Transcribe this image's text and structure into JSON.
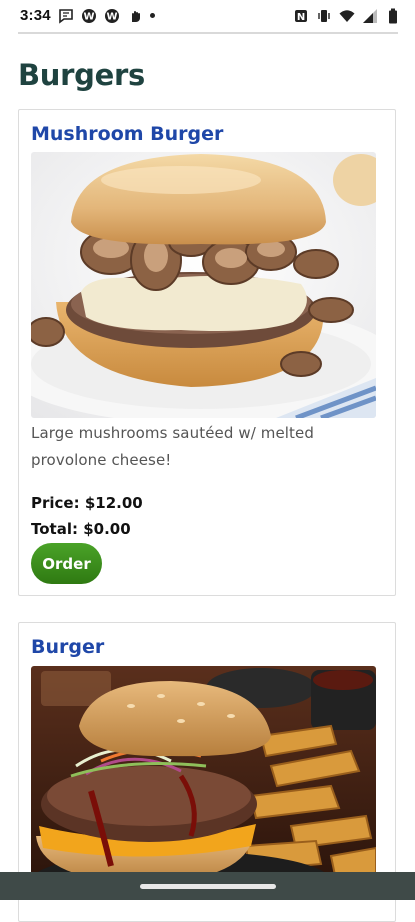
{
  "status_bar": {
    "time": "3:34",
    "left_icons": [
      "message-icon",
      "wordpress-icon",
      "wordpress-icon",
      "hand-icon",
      "dot-icon"
    ],
    "right_icons": [
      "nfc-icon",
      "vibrate-icon",
      "wifi-icon",
      "signal-icon",
      "battery-icon"
    ]
  },
  "page": {
    "title": "Burgers"
  },
  "items": [
    {
      "name": "Mushroom Burger",
      "description": "Large mushrooms sautéed w/ melted provolone cheese!",
      "price": "Price: $12.00",
      "total": "Total: $0.00",
      "order_label": "Order"
    },
    {
      "name": "Burger"
    }
  ],
  "colors": {
    "title": "#1f4340",
    "item_name": "#1f47a8",
    "order_button": "#3a8c1c",
    "nav_bar": "#3f4a48"
  }
}
